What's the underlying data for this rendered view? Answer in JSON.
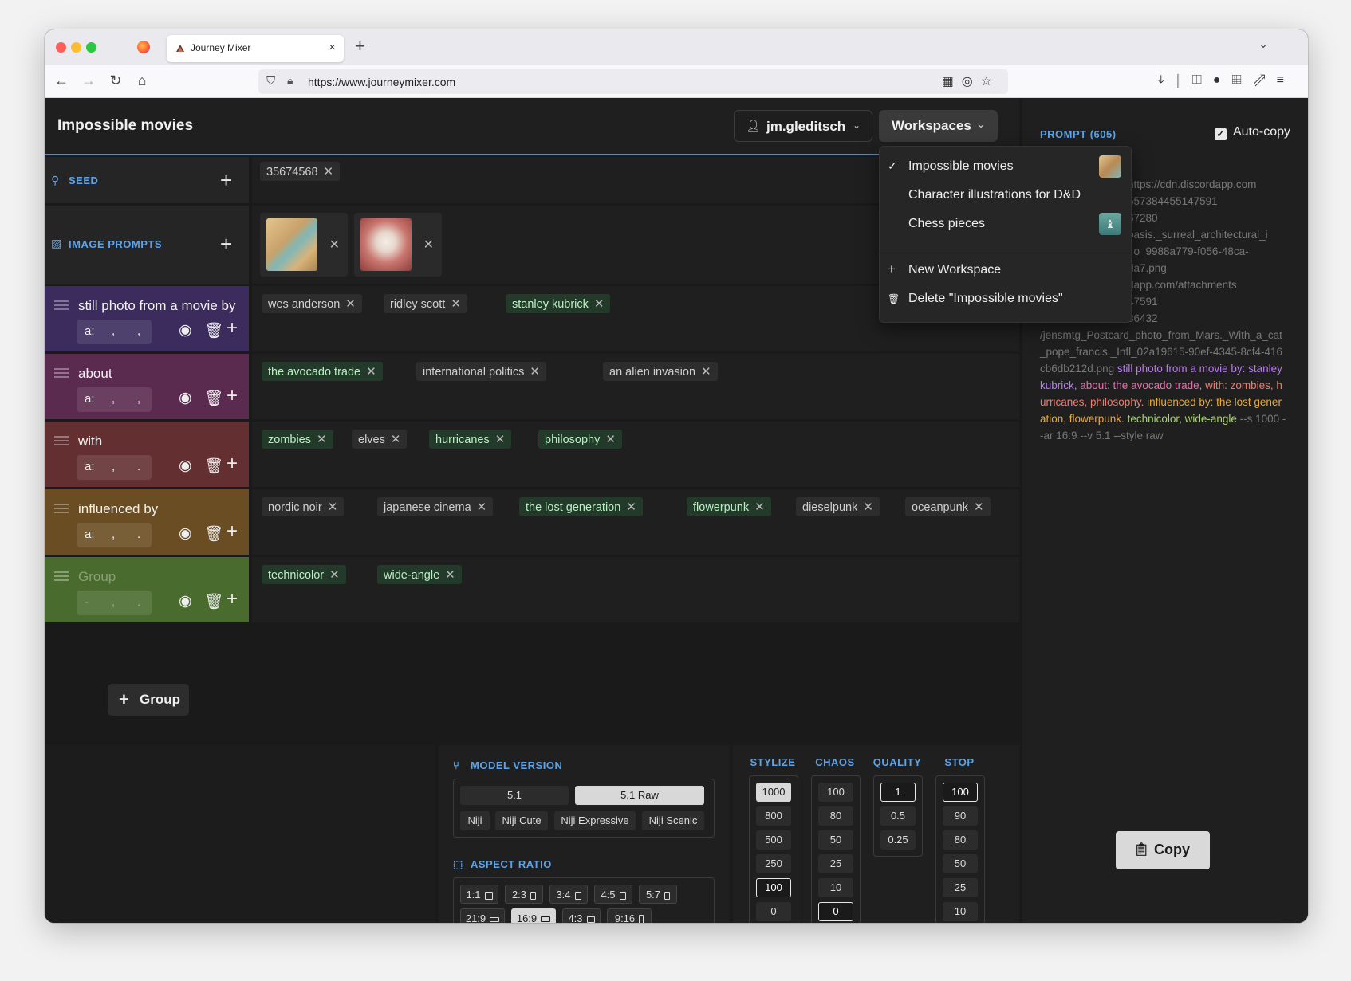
{
  "browser": {
    "tab_title": "Journey Mixer",
    "url": "https://www.journeymixer.com"
  },
  "header": {
    "workspace_title": "Impossible movies",
    "user": "jm.gleditsch",
    "workspaces_label": "Workspaces"
  },
  "dropdown": {
    "items": [
      {
        "label": "Impossible movies",
        "checked": true
      },
      {
        "label": "Character illustrations for D&D",
        "checked": false
      },
      {
        "label": "Chess pieces",
        "checked": false
      }
    ],
    "new_workspace": "New Workspace",
    "delete_workspace": "Delete \"Impossible movies\""
  },
  "seed": {
    "label": "SEED",
    "value": "35674568"
  },
  "image_prompts": {
    "label": "IMAGE PROMPTS"
  },
  "groups": [
    {
      "name": "still photo from a movie by",
      "color": "#3c2c5e",
      "weight": [
        "a:",
        ",",
        ","
      ],
      "chips": [
        {
          "text": "wes anderson",
          "active": false
        },
        {
          "text": "ridley scott",
          "active": false
        },
        {
          "text": "stanley kubrick",
          "active": true
        }
      ]
    },
    {
      "name": "about",
      "color": "#5a2a4f",
      "weight": [
        "a:",
        ",",
        ","
      ],
      "chips": [
        {
          "text": "the avocado trade",
          "active": true
        },
        {
          "text": "international politics",
          "active": false
        },
        {
          "text": "an alien invasion",
          "active": false
        }
      ]
    },
    {
      "name": "with",
      "color": "#632f30",
      "weight": [
        "a:",
        ",",
        "."
      ],
      "chips": [
        {
          "text": "zombies",
          "active": true
        },
        {
          "text": "elves",
          "active": false
        },
        {
          "text": "hurricanes",
          "active": true
        },
        {
          "text": "philosophy",
          "active": true
        }
      ]
    },
    {
      "name": "influenced by",
      "color": "#6a4d22",
      "weight": [
        "a:",
        ",",
        "."
      ],
      "chips": [
        {
          "text": "nordic noir",
          "active": false
        },
        {
          "text": "japanese cinema",
          "active": false
        },
        {
          "text": "the lost generation",
          "active": true
        },
        {
          "text": "flowerpunk",
          "active": true
        },
        {
          "text": "dieselpunk",
          "active": false
        },
        {
          "text": "oceanpunk",
          "active": false
        }
      ]
    },
    {
      "name": "Group",
      "placeholder": true,
      "color": "#4a6b2e",
      "weight": [
        "-",
        ",",
        "."
      ],
      "chips": [
        {
          "text": "technicolor",
          "active": true
        },
        {
          "text": "wide-angle",
          "active": true
        }
      ]
    }
  ],
  "add_group_label": "Group",
  "model_version": {
    "title": "MODEL VERSION",
    "primary": [
      {
        "label": "5.1",
        "selected": false
      },
      {
        "label": "5.1 Raw",
        "selected": true
      }
    ],
    "niji": [
      "Niji",
      "Niji Cute",
      "Niji Expressive",
      "Niji Scenic"
    ]
  },
  "aspect_ratio": {
    "title": "ASPECT RATIO",
    "row1": [
      "1:1",
      "2:3",
      "3:4",
      "4:5",
      "5:7"
    ],
    "row2": [
      "21:9",
      "16:9",
      "4:3",
      "9:16"
    ],
    "selected": "16:9"
  },
  "params": {
    "stylize": {
      "title": "STYLIZE",
      "values": [
        "1000",
        "800",
        "500",
        "250",
        "100",
        "0"
      ],
      "selected": "1000",
      "outlined": "100"
    },
    "chaos": {
      "title": "CHAOS",
      "values": [
        "100",
        "80",
        "50",
        "25",
        "10",
        "0"
      ],
      "selected": "",
      "outlined": "0"
    },
    "quality": {
      "title": "QUALITY",
      "values": [
        "1",
        "0.5",
        "0.25"
      ],
      "selected": "",
      "outlined": "1"
    },
    "stop": {
      "title": "STOP",
      "values": [
        "100",
        "90",
        "80",
        "50",
        "25",
        "10"
      ],
      "selected": "",
      "outlined": "100"
    }
  },
  "sidebar": {
    "prompt_title": "PROMPT (605)",
    "autocopy_label": "Auto-copy",
    "prompt_lines": [
      "https://cdn.discordapp.com",
      "557384455147591",
      "67280",
      "basis._surreal_architectural_i",
      "_o_9988a779-f056-48ca-",
      "da7.png",
      "dapp.com/attachments",
      "47591",
      "86432"
    ],
    "prompt_tail_gray": "/jensmtg_Postcard_photo_from_Mars._With_a_cat_pope_francis._Infl_02a19615-90ef-4345-8cf4-416cb6db212d.png ",
    "prompt_parts": [
      {
        "text": "still photo from a movie by: stanley kubrick, ",
        "color": "#b67cf0"
      },
      {
        "text": "about: the avocado trade, ",
        "color": "#e86fb0"
      },
      {
        "text": "with: zombies, hurricanes, philosophy. ",
        "color": "#f07a6e"
      },
      {
        "text": "influenced by: the lost generation, flowerpunk. ",
        "color": "#e8a93a"
      },
      {
        "text": "technicolor, wide-angle ",
        "color": "#a8d86a"
      },
      {
        "text": "--s 1000 --ar 16:9 --v 5.1 --style raw",
        "color": "#777777"
      }
    ],
    "copy_label": "Copy"
  }
}
